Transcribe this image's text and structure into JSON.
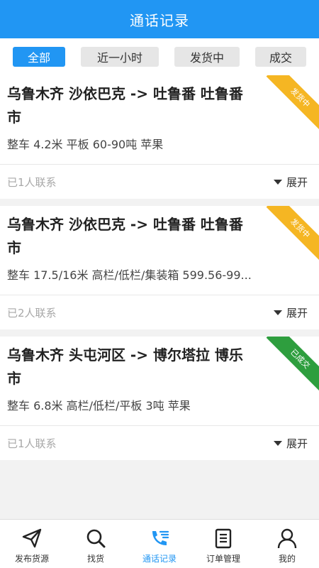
{
  "header": {
    "title": "通话记录"
  },
  "filters": [
    {
      "label": "全部"
    },
    {
      "label": "近一小时"
    },
    {
      "label": "发货中"
    },
    {
      "label": "成交"
    }
  ],
  "cards": [
    {
      "route": "乌鲁木齐 沙依巴克 -> 吐鲁番 吐鲁番市",
      "spec": "整车 4.2米 平板 60-90吨 苹果",
      "contacts": "已1人联系",
      "expand": "展开",
      "badge": "发货中",
      "badge_color": "#f5b623"
    },
    {
      "route": "乌鲁木齐 沙依巴克 -> 吐鲁番 吐鲁番市",
      "spec": "整车 17.5/16米 高栏/低栏/集装箱 599.56-99...",
      "contacts": "已2人联系",
      "expand": "展开",
      "badge": "发货中",
      "badge_color": "#f5b623"
    },
    {
      "route": "乌鲁木齐 头屯河区 -> 博尔塔拉 博乐市",
      "spec": "整车 6.8米 高栏/低栏/平板 3吨 苹果",
      "contacts": "已1人联系",
      "expand": "展开",
      "badge": "已成交",
      "badge_color": "#2e9e3e"
    }
  ],
  "tabbar": [
    {
      "label": "发布货源",
      "icon": "send-icon"
    },
    {
      "label": "找货",
      "icon": "search-icon"
    },
    {
      "label": "通话记录",
      "icon": "phone-log-icon"
    },
    {
      "label": "订单管理",
      "icon": "order-list-icon"
    },
    {
      "label": "我的",
      "icon": "user-icon"
    }
  ],
  "colors": {
    "primary": "#2196f3",
    "pending": "#f5b623",
    "done": "#2e9e3e"
  }
}
